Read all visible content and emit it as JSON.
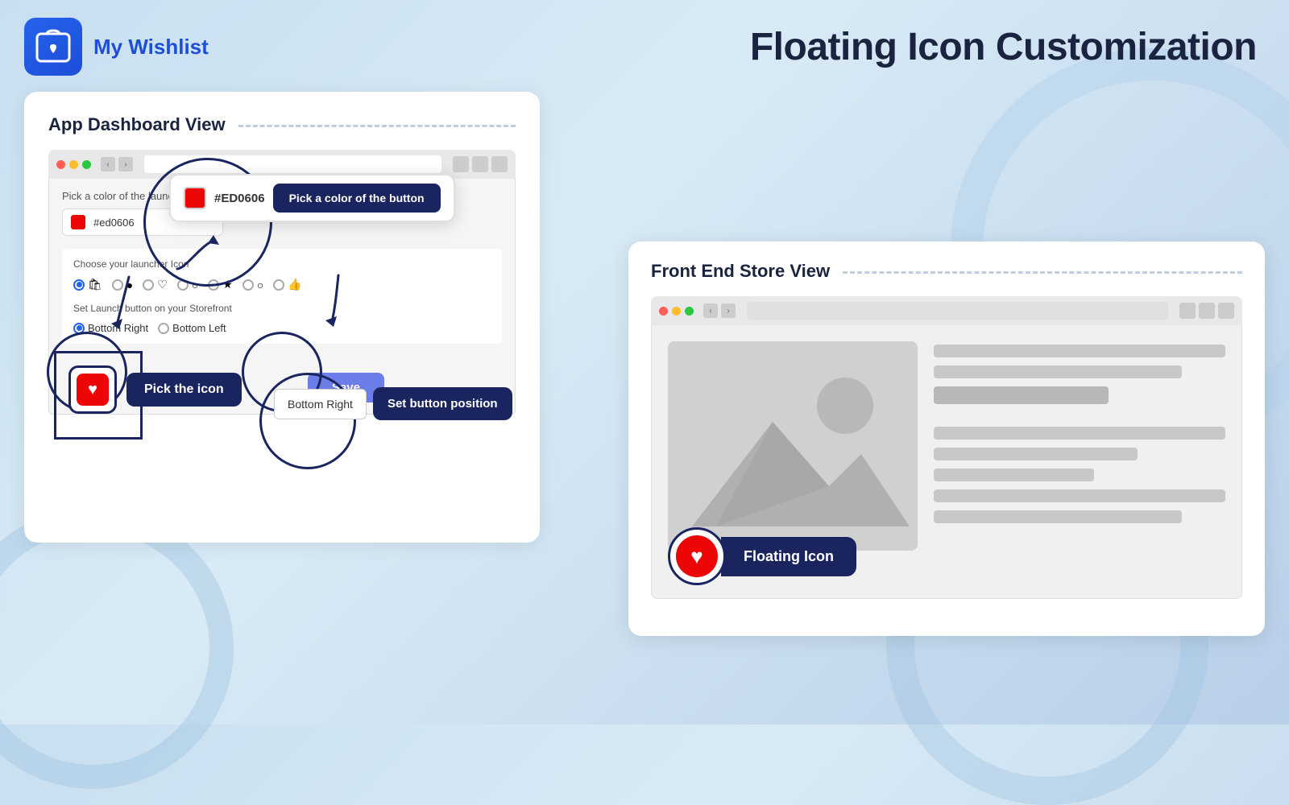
{
  "header": {
    "app_name": "My Wishlist",
    "page_title": "Floating Icon Customization"
  },
  "dashboard_panel": {
    "title": "App Dashboard View",
    "browser": {
      "address_bar_placeholder": ""
    },
    "color_section": {
      "label": "Pick a color of the launch",
      "hex_value": "#ed0606",
      "hex_display": "#ED0606"
    },
    "color_popup": {
      "hex": "#ED0606",
      "button_label": "Pick a color of the button"
    },
    "icon_section": {
      "label": "Choose your launcher Icon",
      "icons": [
        "●",
        "○",
        "♡",
        "○",
        "★",
        "○",
        "👍"
      ],
      "selected_index": 0
    },
    "position_section": {
      "label": "Set Launch button on your Storefront",
      "options": [
        "Bottom Right",
        "Bottom Left"
      ],
      "selected": "Bottom Right"
    },
    "callout_pick_icon": {
      "label": "Pick the icon"
    },
    "callout_set_position": {
      "input_value": "Bottom Right",
      "button_label": "Set button position"
    },
    "save_button": "Save"
  },
  "store_panel": {
    "title": "Front End Store View",
    "floating_icon_label": "Floating Icon"
  },
  "icons": {
    "heart": "♥",
    "bag": "🛍",
    "thumbsup": "👍",
    "star": "★",
    "back": "‹",
    "forward": "›"
  }
}
